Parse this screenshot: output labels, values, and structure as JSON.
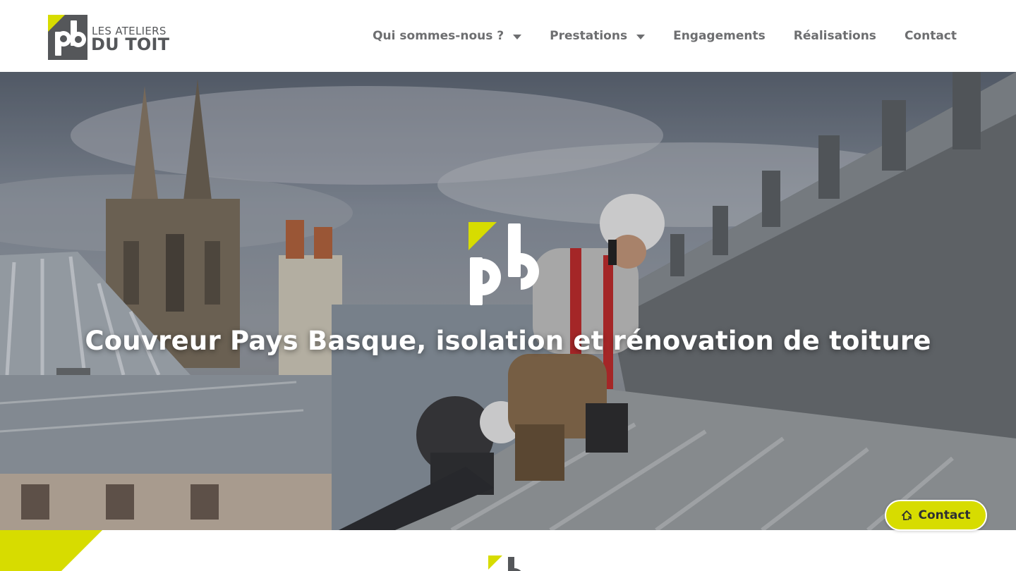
{
  "brand": {
    "name_line1": "LES ATELIERS",
    "name_line2": "DU TOIT",
    "mark_letters": "pb",
    "accent_color": "#d7dc00",
    "text_color": "#55575a"
  },
  "nav": {
    "items": [
      {
        "label": "Qui sommes-nous ?",
        "has_dropdown": true
      },
      {
        "label": "Prestations",
        "has_dropdown": true
      },
      {
        "label": "Engagements",
        "has_dropdown": false
      },
      {
        "label": "Réalisations",
        "has_dropdown": false
      },
      {
        "label": "Contact",
        "has_dropdown": false
      }
    ]
  },
  "hero": {
    "title": "Couvreur Pays Basque, isolation et rénovation de toiture",
    "mark_letters": "pb"
  },
  "floating_contact": {
    "label": "Contact",
    "icon": "house-arrow-icon"
  }
}
